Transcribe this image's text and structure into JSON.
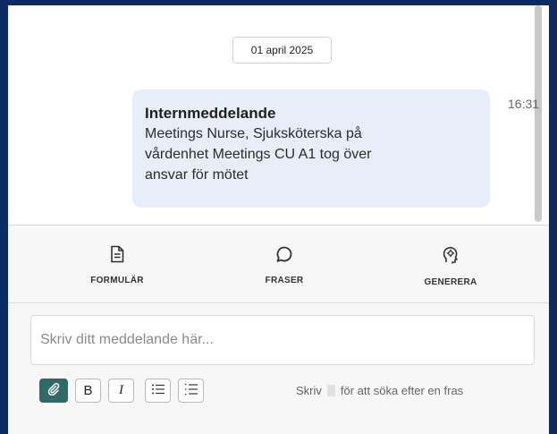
{
  "date_chip": "01 april 2025",
  "message": {
    "title": "Internmeddelande",
    "lines": [
      "Meetings Nurse, Sjuksköterska på",
      "vårdenhet Meetings CU A1 tog över",
      "ansvar för mötet"
    ],
    "time": "16:31"
  },
  "actions": [
    {
      "label": "FORMULÄR",
      "icon": "form-document-icon"
    },
    {
      "label": "FRASER",
      "icon": "speech-bubble-icon"
    },
    {
      "label": "GENERERA",
      "icon": "ai-head-icon"
    }
  ],
  "composer": {
    "placeholder": "Skriv ditt meddelande här...",
    "toolbar": {
      "attach_icon": "paperclip-icon",
      "bold_label": "B",
      "italic_label": "I",
      "bullets_icon": "bullet-list-icon",
      "numbered_icon": "numbered-list-icon"
    },
    "hint_prefix": "Skriv",
    "hint_suffix": "för att söka efter en fras"
  },
  "colors": {
    "frame": "#0b2a66",
    "bubble": "#e8eef8",
    "attach_button": "#2f6b66"
  }
}
